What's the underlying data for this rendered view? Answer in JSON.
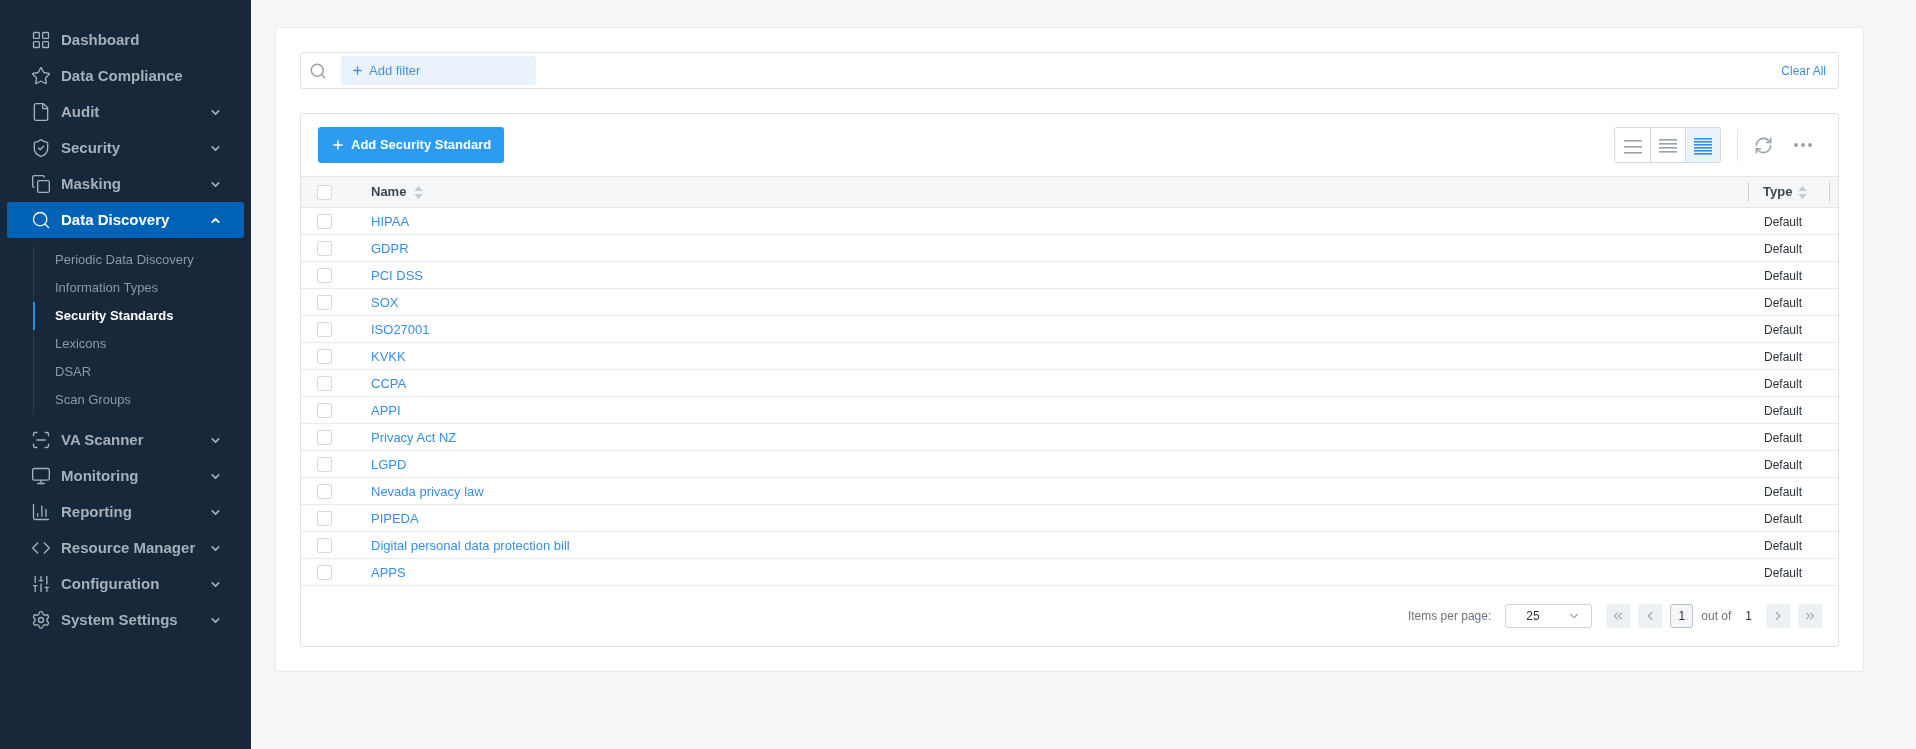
{
  "sidebar": {
    "items": [
      {
        "label": "Dashboard",
        "selected": false
      },
      {
        "label": "Data Compliance",
        "selected": false
      },
      {
        "label": "Audit",
        "expanded": false,
        "selected": false
      },
      {
        "label": "Security",
        "expanded": false,
        "selected": false
      },
      {
        "label": "Masking",
        "expanded": false,
        "selected": false
      },
      {
        "label": "Data Discovery",
        "expanded": true,
        "selected": true,
        "children": [
          {
            "label": "Periodic Data Discovery",
            "selected": false
          },
          {
            "label": "Information Types",
            "selected": false
          },
          {
            "label": "Security Standards",
            "selected": true
          },
          {
            "label": "Lexicons",
            "selected": false
          },
          {
            "label": "DSAR",
            "selected": false
          },
          {
            "label": "Scan Groups",
            "selected": false
          }
        ]
      },
      {
        "label": "VA Scanner",
        "expanded": false,
        "selected": false
      },
      {
        "label": "Monitoring",
        "expanded": false,
        "selected": false
      },
      {
        "label": "Reporting",
        "expanded": false,
        "selected": false
      },
      {
        "label": "Resource Manager",
        "expanded": false,
        "selected": false
      },
      {
        "label": "Configuration",
        "expanded": false,
        "selected": false
      },
      {
        "label": "System Settings",
        "expanded": false,
        "selected": false
      }
    ]
  },
  "filter_bar": {
    "add_filter": "Add filter",
    "clear_all": "Clear All"
  },
  "toolbar": {
    "add_button": "Add Security Standard",
    "density_options": [
      {
        "selected": false
      },
      {
        "selected": false
      },
      {
        "selected": true
      }
    ]
  },
  "table": {
    "columns": [
      "Name",
      "Type"
    ],
    "all_checked": false,
    "rows": [
      {
        "name": "HIPAA",
        "type": "Default",
        "checked": false
      },
      {
        "name": "GDPR",
        "type": "Default",
        "checked": false
      },
      {
        "name": "PCI DSS",
        "type": "Default",
        "checked": false
      },
      {
        "name": "SOX",
        "type": "Default",
        "checked": false
      },
      {
        "name": "ISO27001",
        "type": "Default",
        "checked": false
      },
      {
        "name": "KVKK",
        "type": "Default",
        "checked": false
      },
      {
        "name": "CCPA",
        "type": "Default",
        "checked": false
      },
      {
        "name": "APPI",
        "type": "Default",
        "checked": false
      },
      {
        "name": "Privacy Act NZ",
        "type": "Default",
        "checked": false
      },
      {
        "name": "LGPD",
        "type": "Default",
        "checked": false
      },
      {
        "name": "Nevada privacy law",
        "type": "Default",
        "checked": false
      },
      {
        "name": "PIPEDA",
        "type": "Default",
        "checked": false
      },
      {
        "name": "Digital personal data protection bill",
        "type": "Default",
        "checked": false
      },
      {
        "name": "APPS",
        "type": "Default",
        "checked": false
      }
    ]
  },
  "pagination": {
    "items_per_page_label": "Items per page:",
    "items_per_page": "25",
    "current_page": "1",
    "out_of_label": "out of",
    "total_pages": "1"
  }
}
